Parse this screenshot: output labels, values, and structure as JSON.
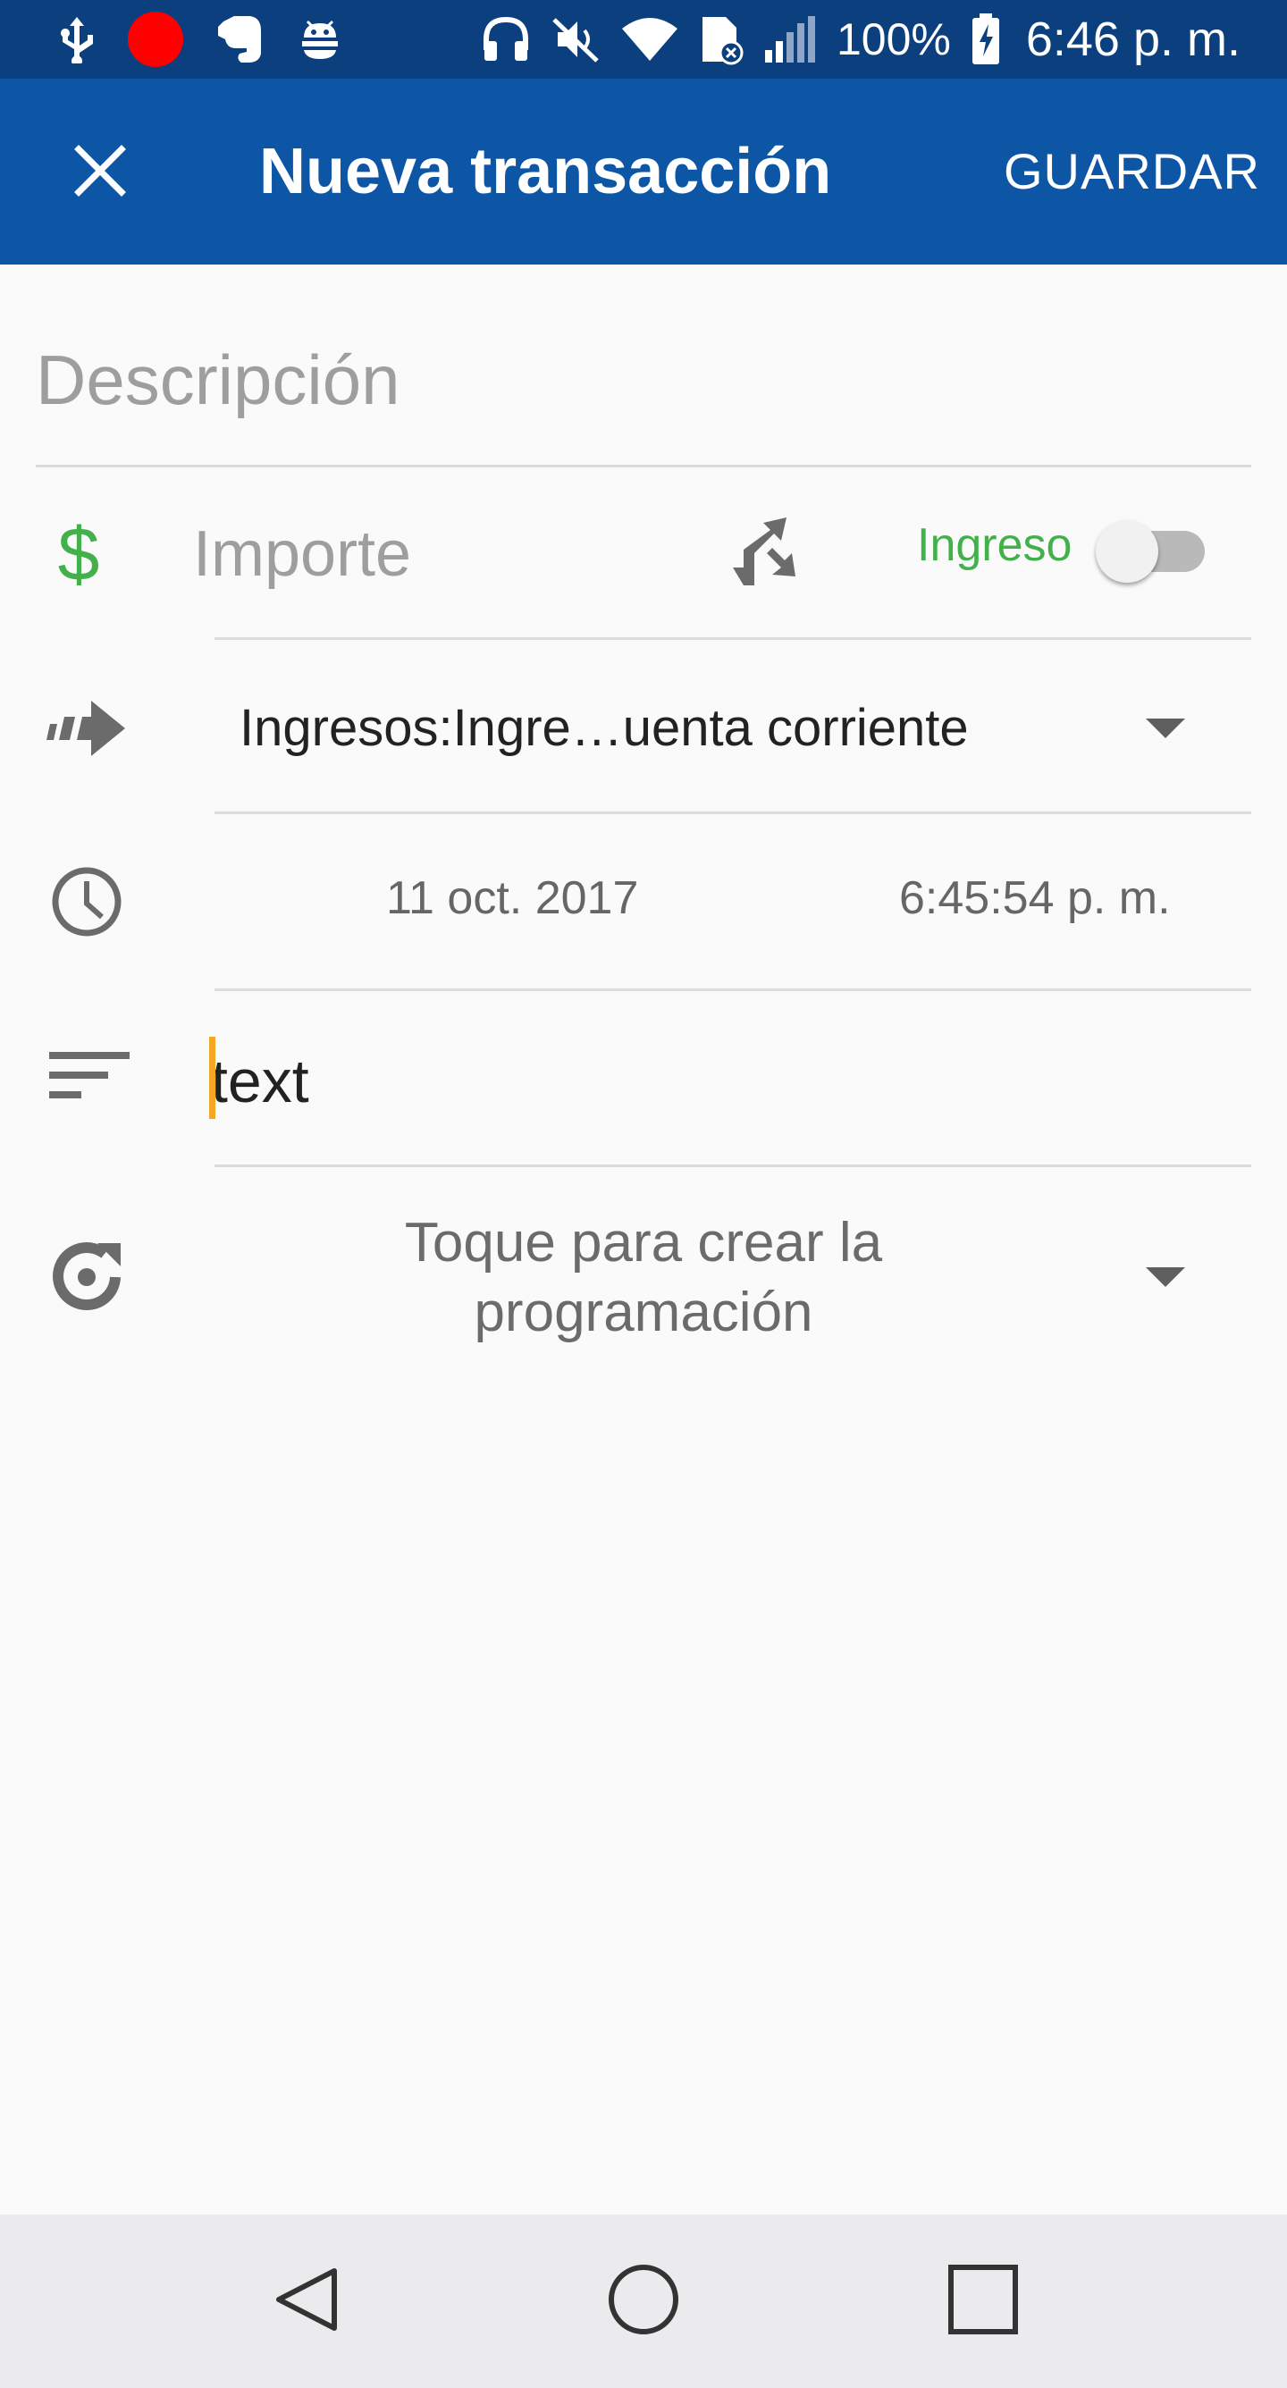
{
  "status_bar": {
    "battery_percent": "100%",
    "time": "6:46 p. m.",
    "recording_dot_color": "#ff0000",
    "icons": [
      "usb-icon",
      "recording-dot-icon",
      "evernote-icon",
      "android-debug-icon",
      "headphones-icon",
      "mute-icon",
      "wifi-icon",
      "sim-blocked-icon",
      "signal-icon",
      "battery-charging-icon"
    ]
  },
  "app_bar": {
    "title": "Nueva transacción",
    "close_icon": "close-icon",
    "save_label": "GUARDAR",
    "background": "#0d55a5"
  },
  "form": {
    "description_placeholder": "Descripción",
    "currency_symbol": "$",
    "currency_color": "#43b14b",
    "amount_placeholder": "Importe",
    "split_icon": "call-split-icon",
    "income_label": "Ingreso",
    "income_toggle_on": false,
    "account": "Ingresos:Ingre…uenta corriente",
    "date": "11 oct. 2017",
    "time": "6:45:54 p. m.",
    "notes_value": "text",
    "schedule_text": "Toque para crear la programación"
  },
  "nav": {
    "back_icon": "back-triangle-icon",
    "home_icon": "home-circle-icon",
    "recents_icon": "recents-square-icon"
  }
}
